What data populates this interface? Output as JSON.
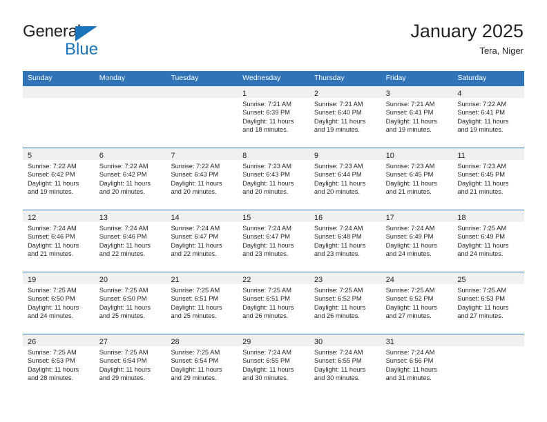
{
  "brand": {
    "word1": "General",
    "word2": "Blue",
    "triangle_color": "#1b75bb"
  },
  "header": {
    "title": "January 2025",
    "location": "Tera, Niger"
  },
  "theme": {
    "header_blue": "#3073b7",
    "daynum_band": "#f0f0f0",
    "text": "#231f20"
  },
  "weekday_headers": [
    "Sunday",
    "Monday",
    "Tuesday",
    "Wednesday",
    "Thursday",
    "Friday",
    "Saturday"
  ],
  "weeks": [
    [
      {
        "day": "",
        "sunrise": "",
        "sunset": "",
        "daylight1": "",
        "daylight2": ""
      },
      {
        "day": "",
        "sunrise": "",
        "sunset": "",
        "daylight1": "",
        "daylight2": ""
      },
      {
        "day": "",
        "sunrise": "",
        "sunset": "",
        "daylight1": "",
        "daylight2": ""
      },
      {
        "day": "1",
        "sunrise": "Sunrise: 7:21 AM",
        "sunset": "Sunset: 6:39 PM",
        "daylight1": "Daylight: 11 hours",
        "daylight2": "and 18 minutes."
      },
      {
        "day": "2",
        "sunrise": "Sunrise: 7:21 AM",
        "sunset": "Sunset: 6:40 PM",
        "daylight1": "Daylight: 11 hours",
        "daylight2": "and 19 minutes."
      },
      {
        "day": "3",
        "sunrise": "Sunrise: 7:21 AM",
        "sunset": "Sunset: 6:41 PM",
        "daylight1": "Daylight: 11 hours",
        "daylight2": "and 19 minutes."
      },
      {
        "day": "4",
        "sunrise": "Sunrise: 7:22 AM",
        "sunset": "Sunset: 6:41 PM",
        "daylight1": "Daylight: 11 hours",
        "daylight2": "and 19 minutes."
      }
    ],
    [
      {
        "day": "5",
        "sunrise": "Sunrise: 7:22 AM",
        "sunset": "Sunset: 6:42 PM",
        "daylight1": "Daylight: 11 hours",
        "daylight2": "and 19 minutes."
      },
      {
        "day": "6",
        "sunrise": "Sunrise: 7:22 AM",
        "sunset": "Sunset: 6:42 PM",
        "daylight1": "Daylight: 11 hours",
        "daylight2": "and 20 minutes."
      },
      {
        "day": "7",
        "sunrise": "Sunrise: 7:22 AM",
        "sunset": "Sunset: 6:43 PM",
        "daylight1": "Daylight: 11 hours",
        "daylight2": "and 20 minutes."
      },
      {
        "day": "8",
        "sunrise": "Sunrise: 7:23 AM",
        "sunset": "Sunset: 6:43 PM",
        "daylight1": "Daylight: 11 hours",
        "daylight2": "and 20 minutes."
      },
      {
        "day": "9",
        "sunrise": "Sunrise: 7:23 AM",
        "sunset": "Sunset: 6:44 PM",
        "daylight1": "Daylight: 11 hours",
        "daylight2": "and 20 minutes."
      },
      {
        "day": "10",
        "sunrise": "Sunrise: 7:23 AM",
        "sunset": "Sunset: 6:45 PM",
        "daylight1": "Daylight: 11 hours",
        "daylight2": "and 21 minutes."
      },
      {
        "day": "11",
        "sunrise": "Sunrise: 7:23 AM",
        "sunset": "Sunset: 6:45 PM",
        "daylight1": "Daylight: 11 hours",
        "daylight2": "and 21 minutes."
      }
    ],
    [
      {
        "day": "12",
        "sunrise": "Sunrise: 7:24 AM",
        "sunset": "Sunset: 6:46 PM",
        "daylight1": "Daylight: 11 hours",
        "daylight2": "and 21 minutes."
      },
      {
        "day": "13",
        "sunrise": "Sunrise: 7:24 AM",
        "sunset": "Sunset: 6:46 PM",
        "daylight1": "Daylight: 11 hours",
        "daylight2": "and 22 minutes."
      },
      {
        "day": "14",
        "sunrise": "Sunrise: 7:24 AM",
        "sunset": "Sunset: 6:47 PM",
        "daylight1": "Daylight: 11 hours",
        "daylight2": "and 22 minutes."
      },
      {
        "day": "15",
        "sunrise": "Sunrise: 7:24 AM",
        "sunset": "Sunset: 6:47 PM",
        "daylight1": "Daylight: 11 hours",
        "daylight2": "and 23 minutes."
      },
      {
        "day": "16",
        "sunrise": "Sunrise: 7:24 AM",
        "sunset": "Sunset: 6:48 PM",
        "daylight1": "Daylight: 11 hours",
        "daylight2": "and 23 minutes."
      },
      {
        "day": "17",
        "sunrise": "Sunrise: 7:24 AM",
        "sunset": "Sunset: 6:49 PM",
        "daylight1": "Daylight: 11 hours",
        "daylight2": "and 24 minutes."
      },
      {
        "day": "18",
        "sunrise": "Sunrise: 7:25 AM",
        "sunset": "Sunset: 6:49 PM",
        "daylight1": "Daylight: 11 hours",
        "daylight2": "and 24 minutes."
      }
    ],
    [
      {
        "day": "19",
        "sunrise": "Sunrise: 7:25 AM",
        "sunset": "Sunset: 6:50 PM",
        "daylight1": "Daylight: 11 hours",
        "daylight2": "and 24 minutes."
      },
      {
        "day": "20",
        "sunrise": "Sunrise: 7:25 AM",
        "sunset": "Sunset: 6:50 PM",
        "daylight1": "Daylight: 11 hours",
        "daylight2": "and 25 minutes."
      },
      {
        "day": "21",
        "sunrise": "Sunrise: 7:25 AM",
        "sunset": "Sunset: 6:51 PM",
        "daylight1": "Daylight: 11 hours",
        "daylight2": "and 25 minutes."
      },
      {
        "day": "22",
        "sunrise": "Sunrise: 7:25 AM",
        "sunset": "Sunset: 6:51 PM",
        "daylight1": "Daylight: 11 hours",
        "daylight2": "and 26 minutes."
      },
      {
        "day": "23",
        "sunrise": "Sunrise: 7:25 AM",
        "sunset": "Sunset: 6:52 PM",
        "daylight1": "Daylight: 11 hours",
        "daylight2": "and 26 minutes."
      },
      {
        "day": "24",
        "sunrise": "Sunrise: 7:25 AM",
        "sunset": "Sunset: 6:52 PM",
        "daylight1": "Daylight: 11 hours",
        "daylight2": "and 27 minutes."
      },
      {
        "day": "25",
        "sunrise": "Sunrise: 7:25 AM",
        "sunset": "Sunset: 6:53 PM",
        "daylight1": "Daylight: 11 hours",
        "daylight2": "and 27 minutes."
      }
    ],
    [
      {
        "day": "26",
        "sunrise": "Sunrise: 7:25 AM",
        "sunset": "Sunset: 6:53 PM",
        "daylight1": "Daylight: 11 hours",
        "daylight2": "and 28 minutes."
      },
      {
        "day": "27",
        "sunrise": "Sunrise: 7:25 AM",
        "sunset": "Sunset: 6:54 PM",
        "daylight1": "Daylight: 11 hours",
        "daylight2": "and 29 minutes."
      },
      {
        "day": "28",
        "sunrise": "Sunrise: 7:25 AM",
        "sunset": "Sunset: 6:54 PM",
        "daylight1": "Daylight: 11 hours",
        "daylight2": "and 29 minutes."
      },
      {
        "day": "29",
        "sunrise": "Sunrise: 7:24 AM",
        "sunset": "Sunset: 6:55 PM",
        "daylight1": "Daylight: 11 hours",
        "daylight2": "and 30 minutes."
      },
      {
        "day": "30",
        "sunrise": "Sunrise: 7:24 AM",
        "sunset": "Sunset: 6:55 PM",
        "daylight1": "Daylight: 11 hours",
        "daylight2": "and 30 minutes."
      },
      {
        "day": "31",
        "sunrise": "Sunrise: 7:24 AM",
        "sunset": "Sunset: 6:56 PM",
        "daylight1": "Daylight: 11 hours",
        "daylight2": "and 31 minutes."
      },
      {
        "day": "",
        "sunrise": "",
        "sunset": "",
        "daylight1": "",
        "daylight2": ""
      }
    ]
  ]
}
